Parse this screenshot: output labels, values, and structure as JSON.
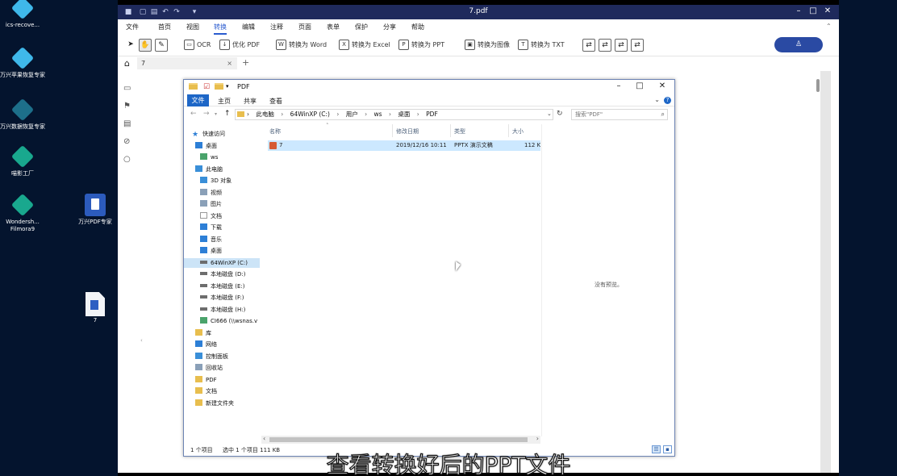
{
  "desktop": {
    "icons": [
      {
        "label": "ics-recove..."
      },
      {
        "label": "万兴苹果恢复专家"
      },
      {
        "label": "万兴数据恢复专家"
      },
      {
        "label": "喵影工厂"
      },
      {
        "label": "Wondersh... Filmora9"
      },
      {
        "label": "万兴PDF专家"
      },
      {
        "label": "7"
      }
    ]
  },
  "app": {
    "title": "7.pdf",
    "menu": [
      "文件",
      "首页",
      "视图",
      "转换",
      "编辑",
      "注释",
      "页面",
      "表单",
      "保护",
      "分享",
      "帮助"
    ],
    "active_menu": "转换",
    "toolbar": {
      "ocr": "OCR",
      "optimize": "优化 PDF",
      "to_word": "转换为 Word",
      "to_excel": "转换为 Excel",
      "to_ppt": "转换为 PPT",
      "to_image": "转换为图像",
      "to_txt": "转换为 TXT"
    },
    "tab": {
      "label": "7",
      "close": "×",
      "add": "+"
    }
  },
  "explorer": {
    "title": "PDF",
    "ribbon": {
      "file": "文件",
      "home": "主页",
      "share": "共享",
      "view": "查看"
    },
    "address": [
      "此电脑",
      "64WinXP (C:)",
      "用户",
      "ws",
      "桌面",
      "PDF"
    ],
    "address_sep": "›",
    "search_placeholder": "搜索\"PDF\"",
    "nav": [
      {
        "label": "快速访问",
        "icon": "star-icon"
      },
      {
        "label": "桌面",
        "icon": "desktop-icon"
      },
      {
        "label": "ws",
        "icon": "user-icon"
      },
      {
        "label": "此电脑",
        "icon": "pc-icon"
      },
      {
        "label": "3D 对象",
        "icon": "cube-icon"
      },
      {
        "label": "视频",
        "icon": "video-icon"
      },
      {
        "label": "图片",
        "icon": "picture-icon"
      },
      {
        "label": "文档",
        "icon": "document-icon"
      },
      {
        "label": "下载",
        "icon": "download-icon"
      },
      {
        "label": "音乐",
        "icon": "music-icon"
      },
      {
        "label": "桌面",
        "icon": "desktop-icon"
      },
      {
        "label": "64WinXP (C:)",
        "icon": "drive-icon"
      },
      {
        "label": "本地磁盘 (D:)",
        "icon": "drive-icon"
      },
      {
        "label": "本地磁盘 (E:)",
        "icon": "drive-icon"
      },
      {
        "label": "本地磁盘 (F:)",
        "icon": "drive-icon"
      },
      {
        "label": "本地磁盘 (H:)",
        "icon": "drive-icon"
      },
      {
        "label": "CI666 (\\\\wsnas.v",
        "icon": "network-drive-icon"
      },
      {
        "label": "库",
        "icon": "library-icon"
      },
      {
        "label": "网络",
        "icon": "network-icon"
      },
      {
        "label": "控制面板",
        "icon": "control-panel-icon"
      },
      {
        "label": "回收站",
        "icon": "recycle-bin-icon"
      },
      {
        "label": "PDF",
        "icon": "folder-icon"
      },
      {
        "label": "文档",
        "icon": "folder-icon"
      },
      {
        "label": "新建文件夹",
        "icon": "folder-icon"
      }
    ],
    "selected_nav": "64WinXP (C:)",
    "columns": [
      "名称",
      "修改日期",
      "类型",
      "大小"
    ],
    "files": [
      {
        "name": "7",
        "modified": "2019/12/16 10:11",
        "type": "PPTX 演示文稿",
        "size": "112 K"
      }
    ],
    "preview_text": "没有预览。",
    "status": {
      "count": "1 个项目",
      "selected": "选中 1 个项目 111 KB"
    }
  },
  "subtitle": "查看转换好后的PPT文件"
}
